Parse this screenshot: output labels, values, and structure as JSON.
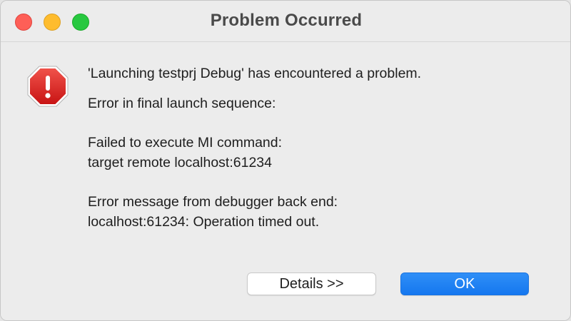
{
  "window": {
    "title": "Problem Occurred"
  },
  "icon": {
    "name": "stop-error-icon",
    "color": "#d81f1f",
    "glyph": "!"
  },
  "message": {
    "heading": "'Launching testprj Debug' has encountered a problem.",
    "lines": [
      "Error in final launch sequence:",
      "",
      "Failed to execute MI command:",
      "target remote localhost:61234",
      "",
      "Error message from debugger back end:",
      "localhost:61234: Operation timed out."
    ]
  },
  "buttons": {
    "details_label": "Details >>",
    "ok_label": "OK"
  },
  "colors": {
    "accent": "#1577ef",
    "close": "#fe5f57",
    "minimize": "#febc2e",
    "maximize": "#28c840"
  }
}
